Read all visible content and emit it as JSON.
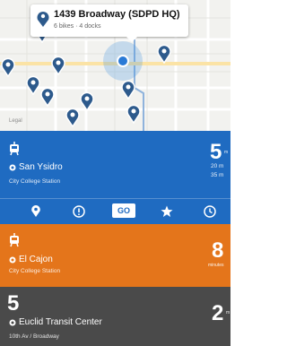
{
  "map": {
    "callout": {
      "title": "1439 Broadway (SDPD HQ)",
      "subtitle": "6 bikes · 4 docks"
    },
    "legal_label": "Legal",
    "pin_icon": "bike-station-pin-icon",
    "location_icon": "current-location-icon"
  },
  "colors": {
    "blue": "#1f6bc1",
    "orange": "#e4751b",
    "gray": "#4a4a4a",
    "pin": "#2d5a8c"
  },
  "departures": [
    {
      "route_icon": "trolley-icon",
      "destination": "San Ysidro",
      "stop": "City College Station",
      "minutes": "5",
      "unit": "m",
      "next": [
        "20 m",
        "35 m"
      ]
    },
    {
      "route_icon": "trolley-icon",
      "destination": "El Cajon",
      "stop": "City College Station",
      "minutes": "8",
      "unit": "minutes"
    },
    {
      "route_number": "5",
      "destination": "Euclid Transit Center",
      "stop": "10th Av / Broadway",
      "minutes": "2",
      "unit": "m"
    }
  ],
  "toolbar": {
    "go_label": "GO",
    "icons": [
      "map-pin-icon",
      "alert-icon",
      "go-button",
      "star-icon",
      "clock-icon"
    ]
  }
}
